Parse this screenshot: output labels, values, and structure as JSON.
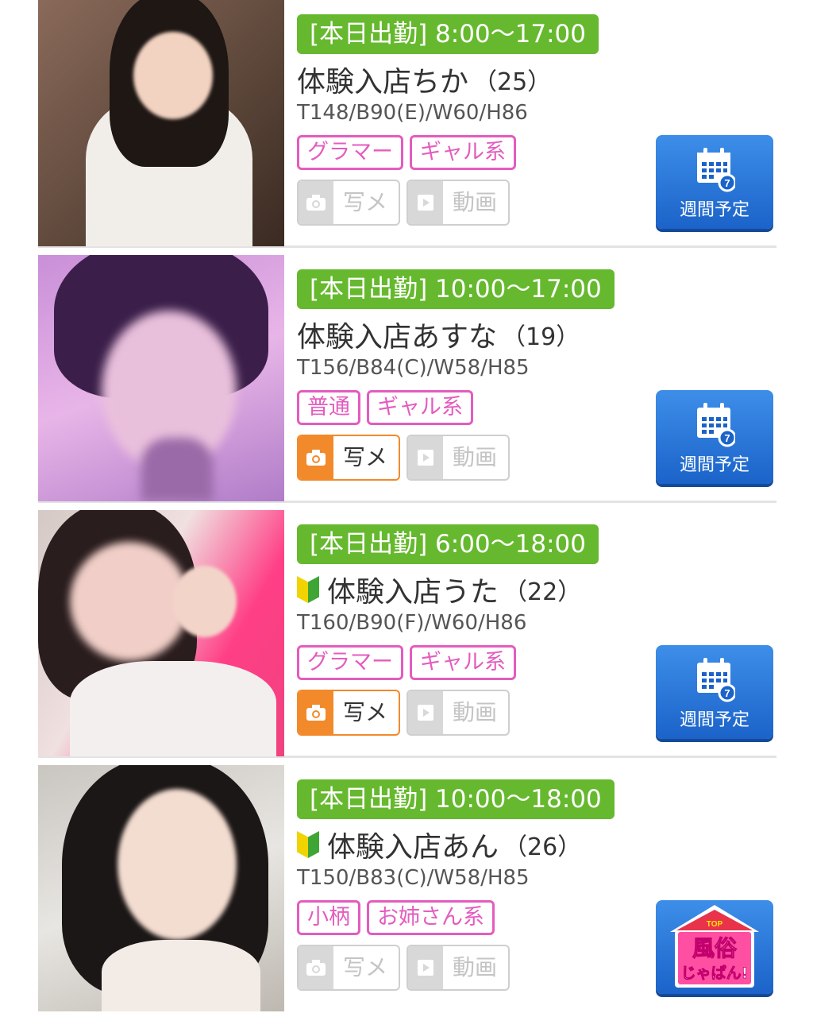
{
  "weekly_label": "週間予定",
  "photo_label": "写メ",
  "video_label": "動画",
  "cards": [
    {
      "shift": "[本日出勤] 8:00～17:00",
      "name": "体験入店ちか",
      "age": "（25）",
      "specs": "T148/B90(E)/W60/H86",
      "tags": [
        "グラマー",
        "ギャル系"
      ],
      "beginner": false,
      "photo_active": false,
      "video_active": false
    },
    {
      "shift": "[本日出勤] 10:00～17:00",
      "name": "体験入店あすな",
      "age": "（19）",
      "specs": "T156/B84(C)/W58/H85",
      "tags": [
        "普通",
        "ギャル系"
      ],
      "beginner": false,
      "photo_active": true,
      "video_active": false
    },
    {
      "shift": "[本日出勤] 6:00～18:00",
      "name": "体験入店うた",
      "age": "（22）",
      "specs": "T160/B90(F)/W60/H86",
      "tags": [
        "グラマー",
        "ギャル系"
      ],
      "beginner": true,
      "photo_active": true,
      "video_active": false
    },
    {
      "shift": "[本日出勤] 10:00～18:00",
      "name": "体験入店あん",
      "age": "（26）",
      "specs": "T150/B83(C)/W58/H85",
      "tags": [
        "小柄",
        "お姉さん系"
      ],
      "beginner": true,
      "photo_active": false,
      "video_active": false
    }
  ],
  "logo": {
    "top": "TOP",
    "line1": "風俗",
    "line2": "じゃぱん!"
  },
  "colors": {
    "shift_green": "#66b92e",
    "tag_pink": "#e45cbf",
    "photo_orange": "#f28a2b",
    "button_blue": "#1b63c9"
  }
}
